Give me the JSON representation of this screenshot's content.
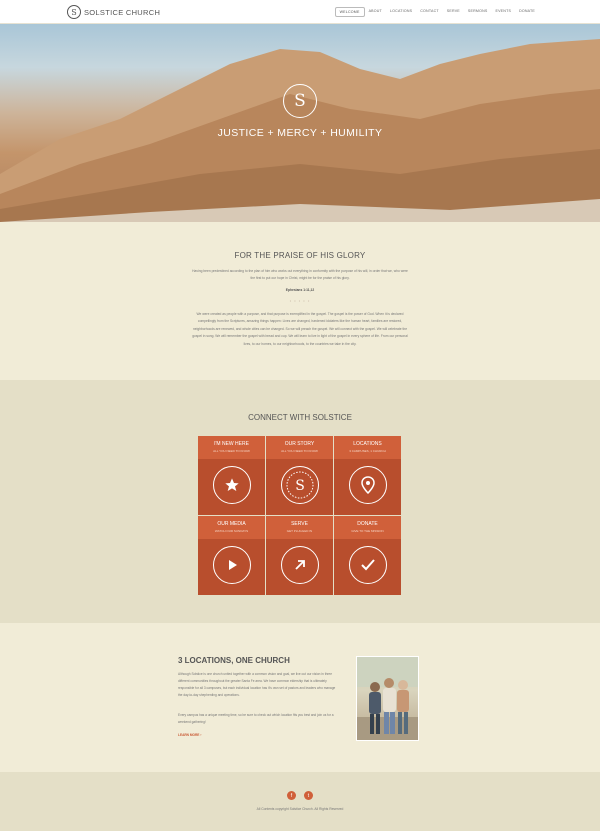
{
  "header": {
    "logo_mark": "S",
    "logo_text": "SOLSTICE CHURCH",
    "nav": [
      "WELCOME",
      "ABOUT",
      "LOCATIONS",
      "CONTACT",
      "SERVE",
      "SERMONS",
      "EVENTS",
      "DONATE"
    ]
  },
  "hero": {
    "emblem": "S",
    "tagline": "JUSTICE + MERCY + HUMILITY"
  },
  "praise": {
    "title": "FOR THE PRAISE OF HIS GLORY",
    "scripture": "Having been predestined according to the plan of him who works out everything in conformity with the purpose of his will, in order that we, who were the first to put our hope in Christ, might be for the praise of his glory.",
    "reference": "Ephesians 1:11,12",
    "divider": "• • • • •",
    "body": "We were created as people with a purpose, and that purpose is exemplified in the gospel. The gospel is the power of God. When it is declared compellingly from the Scriptures, amazing things happen: Lives are changed, hardened idolaters like the human heart, families are restored, neighborhoods are renewed, and whole cities can be changed. So we will preach the gospel. We will connect with the gospel. We will celebrate the gospel in song. We will remember the gospel with bread and cup. We will learn to live in light of the gospel in every sphere of life. From our personal lives, to our homes, to our neighborhoods, to the countries we take in the city."
  },
  "connect": {
    "title": "CONNECT WITH SOLSTICE",
    "tiles": [
      {
        "title": "I'M NEW HERE",
        "subtitle": "ALL YOU NEED TO KNOW",
        "icon": "star-icon"
      },
      {
        "title": "OUR STORY",
        "subtitle": "ALL YOU NEED TO KNOW",
        "icon": "solstice-emblem-icon"
      },
      {
        "title": "LOCATIONS",
        "subtitle": "3 CAMPUSES, 1 CHURCH",
        "icon": "map-pin-icon"
      },
      {
        "title": "OUR MEDIA",
        "subtitle": "WATCH OUR SUNDAYS",
        "icon": "play-icon"
      },
      {
        "title": "SERVE",
        "subtitle": "GET PLUGGED IN",
        "icon": "arrow-up-right-icon"
      },
      {
        "title": "DONATE",
        "subtitle": "GIVE TO THE MISSION",
        "icon": "check-icon"
      }
    ]
  },
  "locations": {
    "title": "3 LOCATIONS, ONE CHURCH",
    "body": "Although Solstice is one church united together with a common vision and goal, we live out our vision in three different communities throughout the greater Santa Fe area. We have common eldership that is ultimately responsible for all 3 campuses, but each individual location has it's own set of pastors and leaders who manage the day-to-day shepherding and operations.",
    "body2": "Every campus has a unique meeting time, so be sure to check out which location fits you best and join us for a weekend gathering!",
    "more": "LEARN MORE ›"
  },
  "footer": {
    "facebook": "f",
    "twitter": "t",
    "copyright": "All Contents copyright Solstice Church. All Rights Reserved"
  },
  "colors": {
    "accent": "#d0603a",
    "accent_dark": "#b84e2d",
    "cream": "#f1ecd7",
    "beige": "#e4dfc7"
  }
}
